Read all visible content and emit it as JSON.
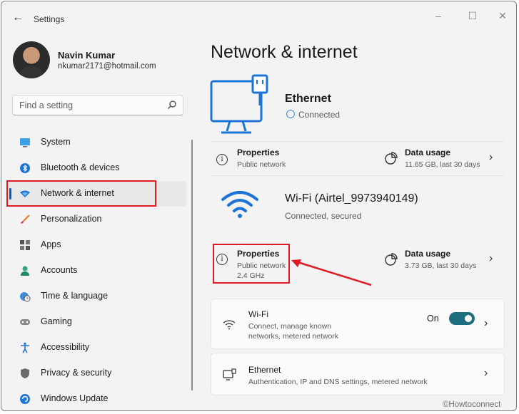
{
  "window": {
    "title": "Settings"
  },
  "user": {
    "name": "Navin Kumar",
    "email": "nkumar2171@hotmail.com"
  },
  "search": {
    "placeholder": "Find a setting"
  },
  "sidebar": {
    "items": [
      {
        "label": "System",
        "icon": "monitor-icon"
      },
      {
        "label": "Bluetooth & devices",
        "icon": "bluetooth-icon"
      },
      {
        "label": "Network & internet",
        "icon": "wifi-diamond-icon",
        "active": true
      },
      {
        "label": "Personalization",
        "icon": "brush-icon"
      },
      {
        "label": "Apps",
        "icon": "apps-grid-icon"
      },
      {
        "label": "Accounts",
        "icon": "person-icon"
      },
      {
        "label": "Time & language",
        "icon": "globe-clock-icon"
      },
      {
        "label": "Gaming",
        "icon": "gamepad-icon"
      },
      {
        "label": "Accessibility",
        "icon": "accessibility-icon"
      },
      {
        "label": "Privacy & security",
        "icon": "shield-icon"
      },
      {
        "label": "Windows Update",
        "icon": "update-icon"
      }
    ]
  },
  "main": {
    "title": "Network & internet",
    "ethernet": {
      "name": "Ethernet",
      "status": "Connected"
    },
    "ethernet_properties": {
      "title": "Properties",
      "sub": "Public network"
    },
    "ethernet_usage": {
      "title": "Data usage",
      "sub": "11.65 GB, last 30 days"
    },
    "wifi": {
      "name": "Wi-Fi (Airtel_9973940149)",
      "status": "Connected, secured"
    },
    "wifi_properties": {
      "title": "Properties",
      "sub1": "Public network",
      "sub2": "2.4 GHz"
    },
    "wifi_usage": {
      "title": "Data usage",
      "sub": "3.73 GB, last 30 days"
    },
    "cards": {
      "wifi": {
        "title": "Wi-Fi",
        "sub1": "Connect, manage known",
        "sub2": "networks, metered network",
        "toggle_label": "On",
        "toggle_on": true
      },
      "ethernet": {
        "title": "Ethernet",
        "sub": "Authentication, IP and DNS settings, metered network"
      }
    }
  },
  "watermark": "©Howtoconnect",
  "colors": {
    "accent": "#005fb8",
    "highlight": "#e01b24",
    "toggle": "#1f6e7e",
    "icon_blue": "#1e74d6"
  }
}
